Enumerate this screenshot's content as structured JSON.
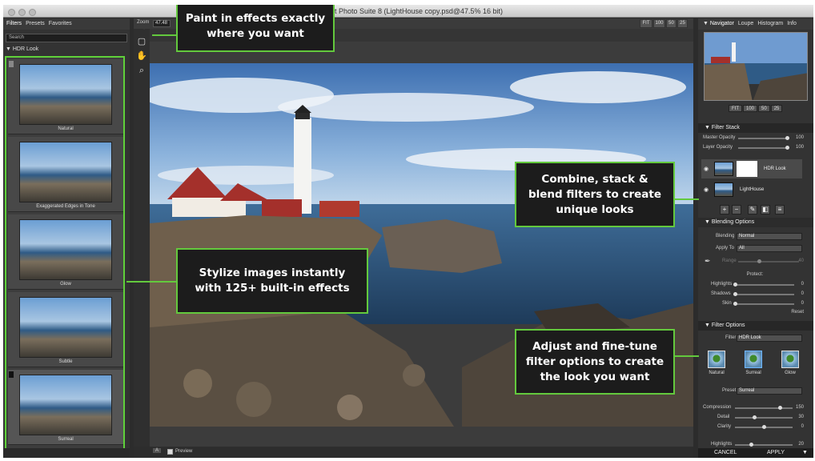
{
  "window": {
    "title": "Perfect Photo Suite 8 (LightHouse copy.psd@47.5% 16 bit)"
  },
  "left_panel": {
    "tabs": [
      "Filters",
      "Presets",
      "Favorites"
    ],
    "search_placeholder": "Search",
    "section": "HDR Look",
    "thumbs": [
      "Natural",
      "Exaggerated Edges in Tone",
      "Glow",
      "Subtle",
      "Surreal"
    ]
  },
  "toolbar": {
    "zoom_label": "Zoom",
    "zoom_value": "47.48",
    "zoom_buttons": [
      "FIT",
      "100",
      "50",
      "25"
    ],
    "preview_badge": "A",
    "preview_label": "Preview"
  },
  "right_panel": {
    "tabs": [
      "Navigator",
      "Loupe",
      "Histogram",
      "Info"
    ],
    "nav_buttons": [
      "FIT",
      "100",
      "50",
      "25"
    ],
    "filter_stack": {
      "title": "Filter Stack",
      "master_opacity_label": "Master Opacity",
      "master_opacity": "100",
      "layer_opacity_label": "Layer Opacity",
      "layer_opacity": "100",
      "layers": [
        "HDR Look",
        "LightHouse"
      ]
    },
    "blending": {
      "title": "Blending Options",
      "blending_label": "Blending",
      "blending_value": "Normal",
      "apply_to_label": "Apply To",
      "apply_to_value": "All",
      "range_label": "Range",
      "range_value": "40",
      "protect_label": "Protect:",
      "highlights_label": "Highlights",
      "highlights_value": "0",
      "shadows_label": "Shadows",
      "shadows_value": "0",
      "skin_label": "Skin",
      "skin_value": "0",
      "reset_label": "Reset"
    },
    "filter_options": {
      "title": "Filter Options",
      "filter_label": "Filter",
      "filter_value": "HDR Look",
      "presets": [
        "Natural",
        "Surreal",
        "Glow"
      ],
      "preset_label": "Preset",
      "preset_value": "Surreal",
      "compression_label": "Compression",
      "compression_value": "150",
      "detail_label": "Detail",
      "detail_value": "30",
      "clarity_label": "Clarity",
      "clarity_value": "0",
      "highlights_label": "Highlights",
      "highlights_value": "20"
    },
    "cancel_label": "CANCEL",
    "apply_label": "APPLY"
  },
  "callouts": {
    "paint": "Paint in effects exactly where you want",
    "stylize": "Stylize images instantly with 125+ built-in effects",
    "combine": "Combine, stack & blend filters to create unique looks",
    "adjust": "Adjust and fine-tune filter options to create the look you want"
  },
  "colors": {
    "callout_border": "#63c93d",
    "callout_bg": "#1c1c1c",
    "panel_bg": "#333333"
  }
}
